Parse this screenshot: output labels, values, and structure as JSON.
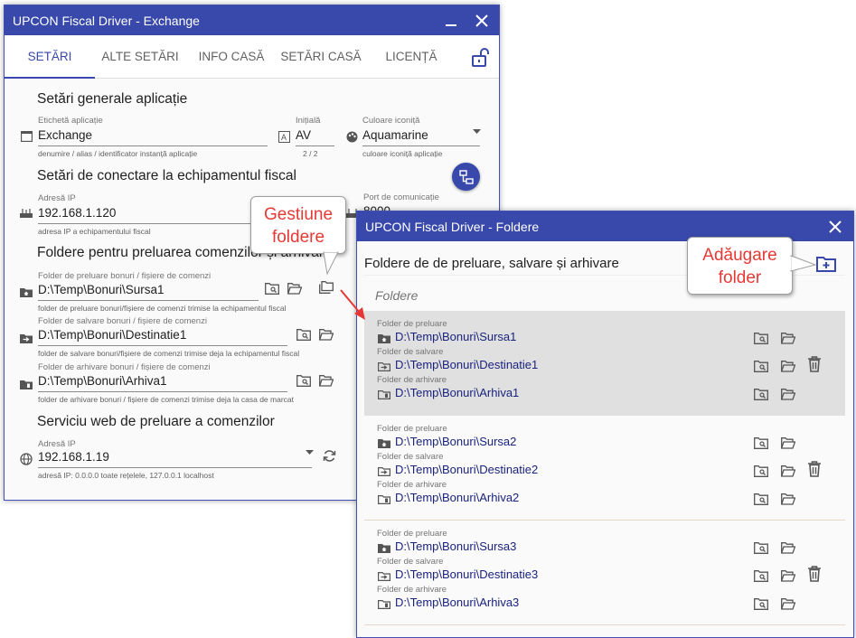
{
  "main_window": {
    "title": "UPCON Fiscal Driver - Exchange",
    "tabs": [
      {
        "label": "SETĂRI",
        "active": true
      },
      {
        "label": "ALTE SETĂRI",
        "active": false
      },
      {
        "label": "INFO CASĂ",
        "active": false
      },
      {
        "label": "SETĂRI CASĂ",
        "active": false
      },
      {
        "label": "LICENȚĂ",
        "active": false
      }
    ],
    "general": {
      "title": "Setări generale aplicație",
      "label_field": {
        "label": "Etichetă aplicație",
        "value": "Exchange",
        "hint": "denumire / alias / identificator instanță aplicație"
      },
      "initial_field": {
        "label": "Inițială",
        "value": "AV",
        "counter": "2 / 2"
      },
      "color_field": {
        "label": "Culoare iconiță",
        "value": "Aquamarine",
        "hint": "culoare iconiță aplicație"
      }
    },
    "connection": {
      "title": "Setări de conectare la echipamentul fiscal",
      "ip_field": {
        "label": "Adresă IP",
        "value": "192.168.1.120",
        "hint": "adresa IP a echipamentului fiscal"
      },
      "port_field": {
        "label": "Port de comunicație",
        "value": "8000"
      }
    },
    "folders": {
      "title": "Foldere pentru preluarea comenzilor și arhivare",
      "rows": [
        {
          "label": "Folder de preluare bonuri / fișiere de comenzi",
          "value": "D:\\Temp\\Bonuri\\Sursa1",
          "hint": "folder de preluare bonuri/fișiere de comenzi trimise la echipamentul fiscal"
        },
        {
          "label": "Folder de salvare bonuri / fișiere de comenzi",
          "value": "D:\\Temp\\Bonuri\\Destinatie1",
          "hint": "folder de salvare bonuri/fișiere de comenzi trimise deja la echipamentul fiscal"
        },
        {
          "label": "Folder de arhivare bonuri / fișiere de comenzi",
          "value": "D:\\Temp\\Bonuri\\Arhiva1",
          "hint": "folder de arhivare bonuri / fișiere de comenzi trimise deja la casa de marcat"
        }
      ]
    },
    "webservice": {
      "title": "Serviciu web de preluare a comenzilor",
      "ip_field": {
        "label": "Adresă IP",
        "value": "192.168.1.19",
        "hint": "adresă IP: 0.0.0.0 toate rețelele, 127.0.0.1 localhost"
      }
    }
  },
  "folders_window": {
    "title": "UPCON Fiscal Driver - Foldere",
    "header": "Foldere de de preluare, salvare și arhivare",
    "list_title": "Foldere",
    "groups": [
      {
        "selected": true,
        "rows": [
          {
            "label": "Folder de preluare",
            "value": "D:\\Temp\\Bonuri\\Sursa1"
          },
          {
            "label": "Folder de salvare",
            "value": "D:\\Temp\\Bonuri\\Destinatie1"
          },
          {
            "label": "Folder de arhivare",
            "value": "D:\\Temp\\Bonuri\\Arhiva1"
          }
        ]
      },
      {
        "selected": false,
        "rows": [
          {
            "label": "Folder de preluare",
            "value": "D:\\Temp\\Bonuri\\Sursa2"
          },
          {
            "label": "Folder de salvare",
            "value": "D:\\Temp\\Bonuri\\Destinatie2"
          },
          {
            "label": "Folder de arhivare",
            "value": "D:\\Temp\\Bonuri\\Arhiva2"
          }
        ]
      },
      {
        "selected": false,
        "rows": [
          {
            "label": "Folder de preluare",
            "value": "D:\\Temp\\Bonuri\\Sursa3"
          },
          {
            "label": "Folder de salvare",
            "value": "D:\\Temp\\Bonuri\\Destinatie3"
          },
          {
            "label": "Folder de arhivare",
            "value": "D:\\Temp\\Bonuri\\Arhiva3"
          }
        ]
      }
    ]
  },
  "callouts": {
    "manage_folders": [
      "Gestiune",
      "foldere"
    ],
    "add_folder": [
      "Adăugare",
      "folder"
    ]
  },
  "colors": {
    "title_bar": "#3949ab",
    "accent": "#3949ab",
    "callout_text": "#e53935",
    "path_text": "#1a237e",
    "selected_group": "#e0e0e0"
  },
  "icons": [
    "minimize-icon",
    "close-icon",
    "lock-open-icon",
    "window-icon",
    "text-format-icon",
    "palette-icon",
    "dropdown-arrow-icon",
    "network-icon",
    "router-icon",
    "folder-home-icon",
    "folder-in-icon",
    "folder-archive-icon",
    "folder-search-icon",
    "folder-open-icon",
    "folder-multiple-icon",
    "globe-icon",
    "refresh-icon",
    "delete-icon",
    "folder-plus-icon"
  ]
}
